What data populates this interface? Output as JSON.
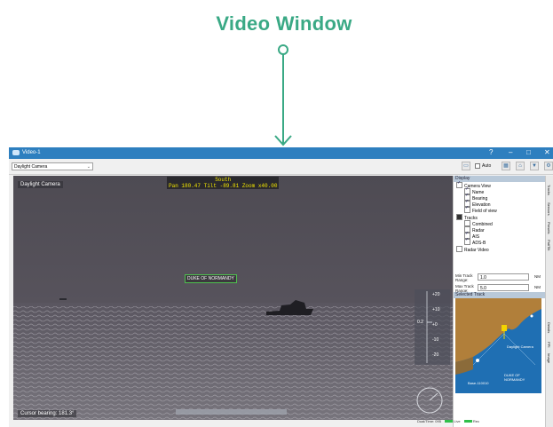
{
  "callout": {
    "title": "Video Window"
  },
  "window": {
    "title": "Video-1",
    "help_icon": "?",
    "minimize_icon": "–",
    "maximize_icon": "□",
    "close_icon": "✕"
  },
  "toolbar": {
    "camera_select": "Daylight Camera",
    "auto_label": "Auto"
  },
  "video": {
    "label": "Daylight Camera",
    "hud_line1": "South",
    "hud_line2": "Pan 180.47  Tilt -89.81  Zoom x40.00",
    "target_label": "DUKE OF NORMANDY",
    "cursor_bearing": "Cursor bearing: 181.3°",
    "scale_ticks": [
      "+20",
      "+10",
      "+0",
      "-10",
      "-20"
    ],
    "scale_marker": "0.2"
  },
  "display": {
    "header": "Display",
    "camera_view": "Camera View",
    "camera_items": [
      "Name",
      "Bearing",
      "Elevation",
      "Field of view"
    ],
    "tracks": "Tracks",
    "track_items": [
      "Combined",
      "Radar",
      "AIS",
      "ADS-B"
    ],
    "radar_video": "Radar Video"
  },
  "ranges": {
    "min_label": "Min Track Range:",
    "min_value": "1.0",
    "min_unit": "NM",
    "max_label": "Max Track Range:",
    "max_value": "5.0",
    "max_unit": "NM"
  },
  "selected_track": {
    "header": "Selected Track",
    "map_camera_label": "Daylight Camera",
    "map_ship_label": "DUKE OF NORMANDY",
    "map_base_label": "Base-110010"
  },
  "side_tabs": [
    "Tracks",
    "Sensors",
    "Presets",
    "Pat/Tilt",
    "Details",
    "PPI",
    "Image"
  ],
  "status": {
    "text": "Dual/Time: 095",
    "live": "Live",
    "record": "Rec"
  },
  "colors": {
    "accent": "#3aa985",
    "titlebar": "#2e7fbf",
    "hud": "#f2e600"
  }
}
